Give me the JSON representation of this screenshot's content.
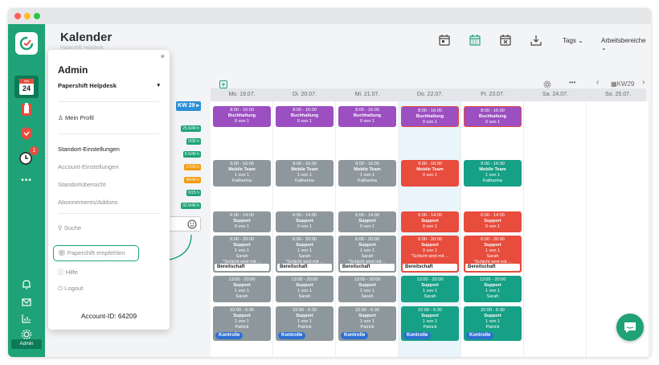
{
  "header": {
    "title": "Kalender",
    "subtitle": "Papershift Helpdesk",
    "tags_label": "Tags",
    "areas_label": "Arbeitsbereiche",
    "week_label": "KW29"
  },
  "sidebar": {
    "calendar_month": "Mai",
    "calendar_day": "24",
    "notification_count": "1",
    "more_label": "•••",
    "admin_label": "Admin"
  },
  "days": [
    {
      "label": "Mo. 19.07."
    },
    {
      "label": "Di. 20.07."
    },
    {
      "label": "Mi. 21.07."
    },
    {
      "label": "Do. 22.07."
    },
    {
      "label": "Fr. 23.07."
    },
    {
      "label": "Sa. 24.07."
    },
    {
      "label": "So. 25.07."
    }
  ],
  "hours": [
    {
      "label": "KW 29 ▸",
      "color": "#2d8fd8"
    },
    {
      "label": "25.5/40 h",
      "color": "#1fa277"
    },
    {
      "label": "0/36 h",
      "color": "#1fa277"
    },
    {
      "label": "6.5/40 h",
      "color": "#1fa277"
    },
    {
      "label": "17/20 h",
      "color": "#f39c12"
    },
    {
      "label": "40/40 h",
      "color": "#f39c12"
    },
    {
      "label": "0/15 h",
      "color": "#1fa277"
    },
    {
      "label": "32.5/40 h",
      "color": "#1fa277"
    }
  ],
  "colors": {
    "green": "#1fa277",
    "purple": "#9b4fc1",
    "gray": "#8e989c",
    "red": "#e74c3c",
    "teal": "#16a085",
    "blue": "#2d6fd1"
  },
  "shifts": {
    "buch": {
      "time": "8:00 - 16:00",
      "name": "Buchhaltung",
      "count": "0 von 1"
    },
    "mobile": {
      "time": "9:00 - 16:00",
      "name": "Mobile Team",
      "count": "1 von 1",
      "person": "Katharina"
    },
    "mobile_empty": {
      "time": "9:00 - 16:00",
      "name": "Mobile Team",
      "count": "0 von 1"
    },
    "sup1": {
      "time": "6:00 - 14:00",
      "name": "Support",
      "count": "0 von 1"
    },
    "sup2": {
      "time": "6:00 - 20:00",
      "name": "Support",
      "count": "1 von 1",
      "person": "Sarah",
      "note": "\"Schicht wird mit ...",
      "tag": "Bereitschaft"
    },
    "sup2_empty": {
      "time": "6:00 - 20:00",
      "name": "Support",
      "count": "0 von 1",
      "note": "\"Schicht wird mit ...",
      "tag": "Bereitschaft"
    },
    "sup3": {
      "time": "13:00 - 20:00",
      "name": "Support",
      "count": "1 von 1",
      "person": "Sarah"
    },
    "sup4": {
      "time": "22:00 - 6:30",
      "name": "Support",
      "count": "1 von 1",
      "person": "Patrick",
      "tag": "Kontrolle"
    }
  },
  "admin_popup": {
    "title": "Admin",
    "company": "Papershift Helpdesk",
    "close": "×",
    "profile": "Mein Profil",
    "location_settings": "Standort-Einstellungen",
    "account_settings": "Account-Einstellungen",
    "location_overview": "Standortübersicht",
    "subscriptions": "Abonnements/Addons",
    "search": "Suche",
    "recommend": "Papershift empfehlen",
    "help": "Hilfe",
    "logout": "Logout",
    "account_id": "Account-ID: 64209"
  }
}
